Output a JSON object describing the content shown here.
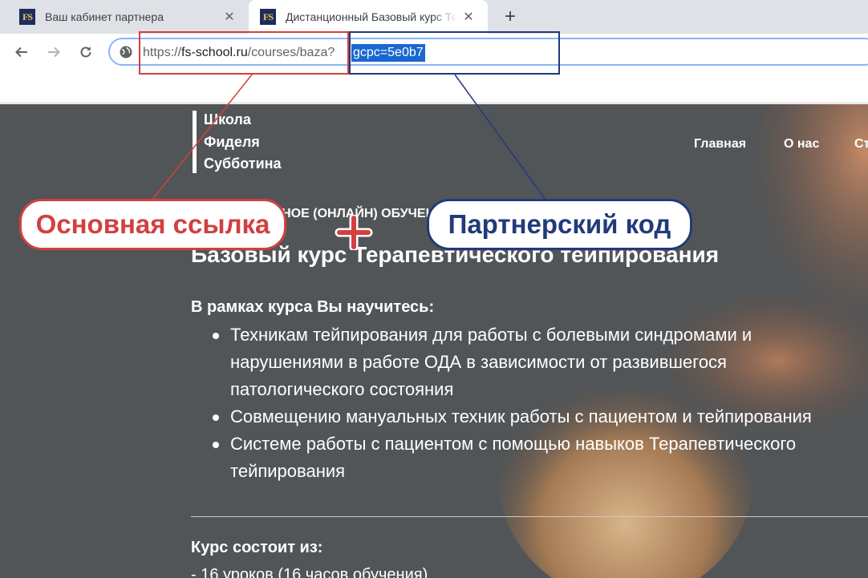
{
  "browser": {
    "tabs": [
      {
        "favicon": "FS",
        "title": "Ваш кабинет партнера",
        "close": "✕"
      },
      {
        "favicon": "FS",
        "title": "Дистанционный Базовый курс Терапевтического тейпирования",
        "close": "✕"
      }
    ],
    "new_tab": "+",
    "url": {
      "scheme": "https://",
      "host": "fs-school.ru",
      "path": "/courses/baza",
      "separator": "?",
      "query": "gcpc=5e0b7"
    }
  },
  "site": {
    "logo_lines": [
      "Школа",
      "Фиделя",
      "Субботина"
    ],
    "nav": [
      "Главная",
      "О нас",
      "Ст"
    ],
    "kicker": "ДИСТАНЦИОННОЕ (ОНЛАЙН) ОБУЧЕНИЕ",
    "headline": "Базовый курс Терапевтического тейпирования",
    "learn_heading": "В рамках курса Вы научитесь:",
    "learn_items": [
      "Техникам тейпирования для работы с болевыми синдромами и нарушениями в работе ОДА в зависимости от развившегося патологического состояния",
      "Совмещению мануальных техник работы с пациентом и тейпирования",
      "Системе работы с пациентом с помощью навыков Терапевтического тейпирования"
    ],
    "course_heading": "Курс состоит из:",
    "course_items": [
      "- 16 уроков (16 часов обучения)"
    ]
  },
  "annotations": {
    "main_link_label": "Основная ссылка",
    "partner_code_label": "Партнерский код",
    "colors": {
      "red": "#d2403f",
      "blue": "#213a7a"
    }
  }
}
